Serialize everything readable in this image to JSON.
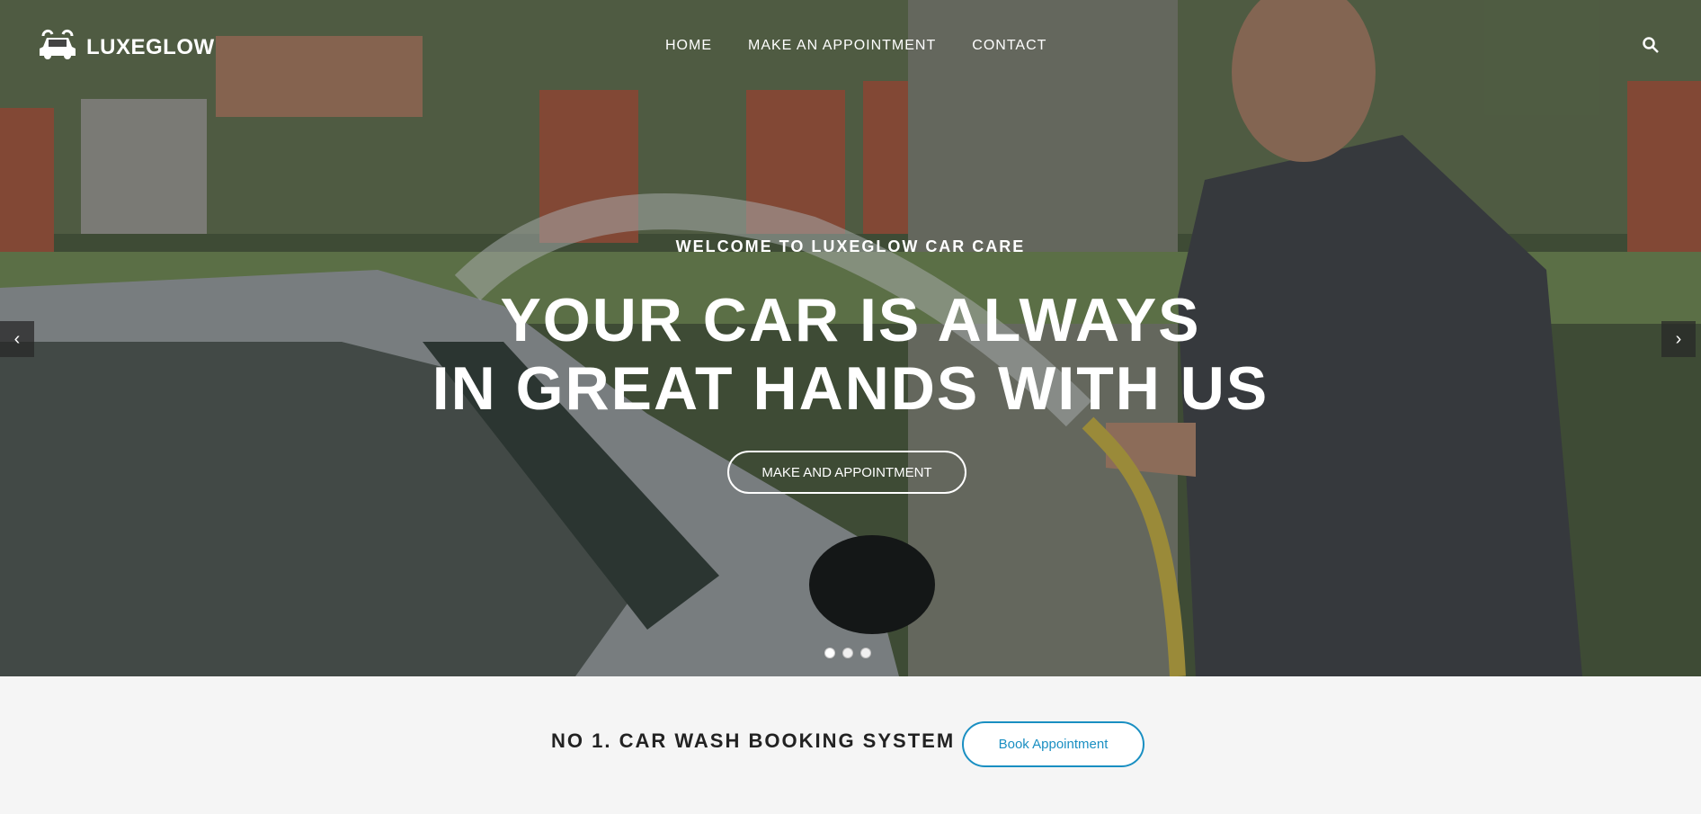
{
  "brand": {
    "name": "LUXEGLOW",
    "icon": "car-wash-icon"
  },
  "nav": {
    "items": [
      {
        "label": "HOME"
      },
      {
        "label": "MAKE AN APPOINTMENT"
      },
      {
        "label": "CONTACT"
      }
    ],
    "search_icon": "search-icon"
  },
  "hero": {
    "eyebrow": "WELCOME TO LUXEGLOW CAR CARE",
    "headline_line1": "YOUR CAR IS ALWAYS",
    "headline_line2": "IN GREAT HANDS WITH US",
    "cta_label": "MAKE AND APPOINTMENT",
    "slides": 3,
    "active_slide": 1,
    "prev_icon": "chevron-left-icon",
    "next_icon": "chevron-right-icon"
  },
  "band": {
    "title": "NO 1. CAR WASH BOOKING SYSTEM",
    "button_label": "Book Appointment"
  },
  "colors": {
    "accent": "#1a8fc2",
    "text_dark": "#222222",
    "white": "#ffffff"
  }
}
